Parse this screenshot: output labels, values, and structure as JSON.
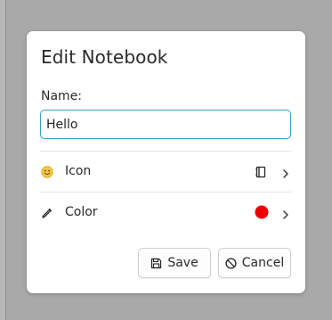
{
  "dialog": {
    "title": "Edit Notebook",
    "name_label": "Name:",
    "name_value": "Hello",
    "rows": [
      {
        "label": "Icon",
        "lead_icon": "smiley-emoji-icon",
        "value_icon": "notebook-icon"
      },
      {
        "label": "Color",
        "lead_icon": "eyedropper-icon",
        "value_color": "#ee0000"
      }
    ],
    "buttons": {
      "save_label": "Save",
      "cancel_label": "Cancel"
    }
  },
  "colors": {
    "accent_border": "#3a9fbf",
    "selected_color": "#ee0000",
    "backdrop": "#a9a9a9"
  }
}
